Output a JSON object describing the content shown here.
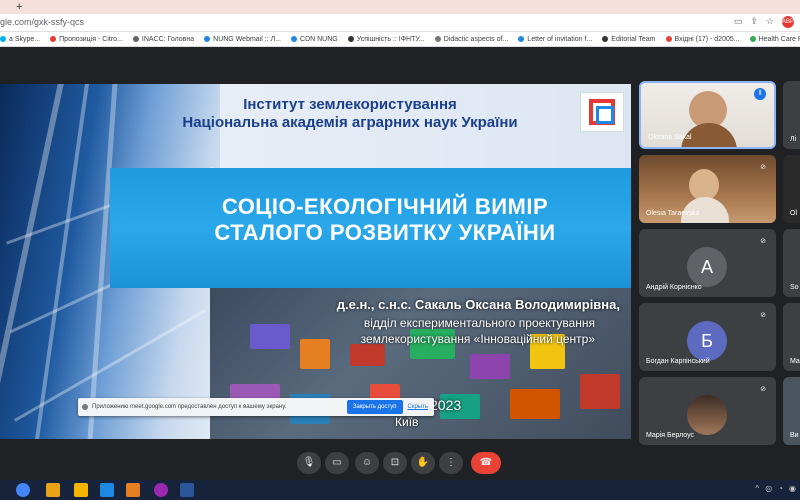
{
  "browser": {
    "new_tab_symbol": "+",
    "url": "gle.com/gxk-ssfy-qcs",
    "toolbar_icons": [
      "camera-icon",
      "share-icon",
      "star-icon"
    ],
    "badge": "ABP"
  },
  "bookmarks": [
    {
      "label": "a Skype...",
      "icon_color": "#00aff0"
    },
    {
      "label": "Пропозиція - Citro...",
      "icon_color": "#e53935"
    },
    {
      "label": "INACC: Головна",
      "icon_color": "#5f6368"
    },
    {
      "label": "NUNG Webmail :: Л...",
      "icon_color": "#1e88e5"
    },
    {
      "label": "CDN NUNG",
      "icon_color": "#1e88e5"
    },
    {
      "label": "Успішність :: ІФНТУ...",
      "icon_color": "#333333"
    },
    {
      "label": "Didactic aspects of...",
      "icon_color": "#777777"
    },
    {
      "label": "Letter of invitation f...",
      "icon_color": "#1e88e5"
    },
    {
      "label": "Editorial Team",
      "icon_color": "#333333"
    },
    {
      "label": "Вхідні (17) - d2005...",
      "icon_color": "#ea4335"
    },
    {
      "label": "Health Care Resou...",
      "icon_color": "#34a853"
    }
  ],
  "slide": {
    "institute_line1": "Інститут землекористування",
    "institute_line2": "Національна академія аграрних наук України",
    "title_line1": "СОЦІО-ЕКОЛОГІЧНИЙ ВИМІР",
    "title_line2": "СТАЛОГО РОЗВИТКУ УКРАЇНИ",
    "author": "д.е.н., с.н.с. Сакаль Оксана Володимирівна,",
    "dept_line1": "відділ експериментального проектування",
    "dept_line2": "землекористування «Інноваційний центр»",
    "year": "2023",
    "city": "Київ"
  },
  "notice": {
    "text": "Приложению meet.google.com предоставлен доступ к вашему экрану.",
    "stop_button": "Закрыть доступ",
    "hide_link": "Скрыть"
  },
  "participants": [
    {
      "name": "Oksana Sakal",
      "type": "video",
      "mic": "speaking"
    },
    {
      "name": "Olesia Taraevska",
      "type": "video",
      "mic": "muted"
    },
    {
      "name": "Андрій Корнієнко",
      "type": "avatar",
      "initial": "А",
      "color": "#5f6368",
      "mic": "muted"
    },
    {
      "name": "Богдан Карпінський",
      "type": "avatar",
      "initial": "Б",
      "color": "#5c6bc0",
      "mic": "muted"
    },
    {
      "name": "Марія Берлоус",
      "type": "photo",
      "mic": "muted"
    }
  ],
  "side_participants": [
    "Лі",
    "Ol",
    "So",
    "Ма",
    "Ви"
  ],
  "controls": [
    "mic-icon",
    "camera-icon",
    "emoji-icon",
    "present-icon",
    "raise-hand-icon",
    "more-icon",
    "end-call-icon"
  ]
}
